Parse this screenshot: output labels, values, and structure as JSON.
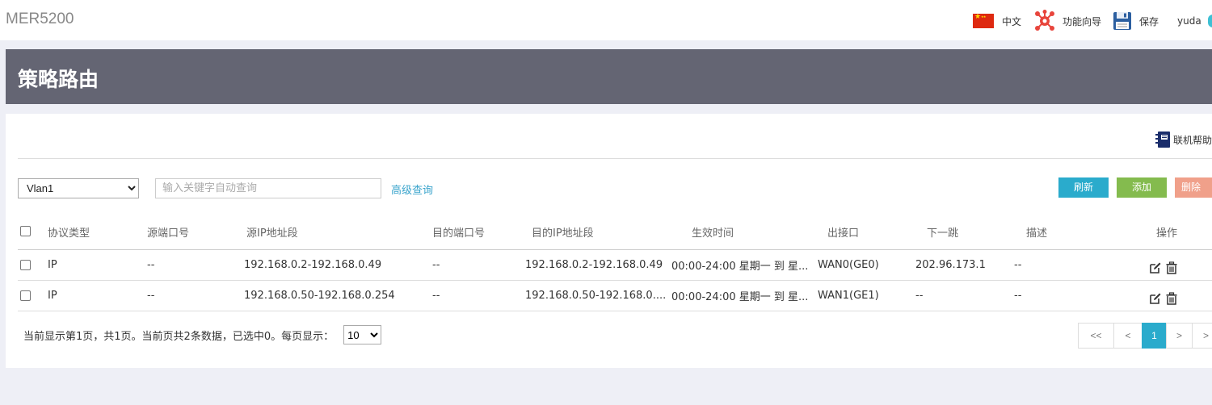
{
  "brand": "MER5200",
  "topbar": {
    "lang_label": "中文",
    "wizard_label": "功能向导",
    "save_label": "保存",
    "user_label": "yuda"
  },
  "page_title": "策略路由",
  "help_label": "联机帮助",
  "toolbar": {
    "vlan_selected": "Vlan1",
    "search_placeholder": "输入关键字自动查询",
    "advanced_query": "高级查询",
    "refresh": "刷新",
    "add": "添加",
    "delete": "删除"
  },
  "table": {
    "headers": {
      "protocol": "协议类型",
      "src_port": "源端口号",
      "src_ip": "源IP地址段",
      "dst_port": "目的端口号",
      "dst_ip": "目的IP地址段",
      "time": "生效时间",
      "out_if": "出接口",
      "next_hop": "下一跳",
      "desc": "描述",
      "ops": "操作"
    },
    "rows": [
      {
        "protocol": "IP",
        "src_port": "--",
        "src_ip": "192.168.0.2-192.168.0.49",
        "dst_port": "--",
        "dst_ip": "192.168.0.2-192.168.0.49",
        "time": "00:00-24:00 星期一 到 星...",
        "out_if": "WAN0(GE0)",
        "next_hop": "202.96.173.1",
        "desc": "--"
      },
      {
        "protocol": "IP",
        "src_port": "--",
        "src_ip": "192.168.0.50-192.168.0.254",
        "dst_port": "--",
        "dst_ip": "192.168.0.50-192.168.0....",
        "time": "00:00-24:00 星期一 到 星...",
        "out_if": "WAN1(GE1)",
        "next_hop": "--",
        "desc": "--"
      }
    ]
  },
  "footer": {
    "info": "当前显示第1页，共1页。当前页共2条数据，已选中0。每页显示：",
    "per_page": "10"
  },
  "pager": {
    "first": "<<",
    "prev": "<",
    "current": "1",
    "next": ">",
    "last": ">"
  },
  "colors": {
    "banner": "#646573",
    "accent": "#2aabcc",
    "add": "#84bb4e",
    "delete": "#f0a08a"
  }
}
